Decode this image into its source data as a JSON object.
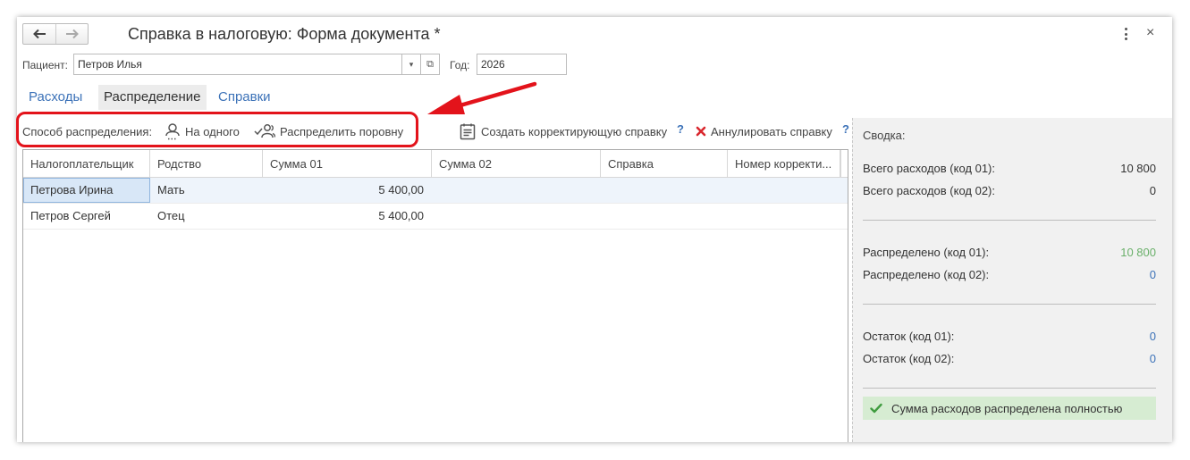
{
  "window": {
    "title": "Справка в налоговую: Форма документа *"
  },
  "header": {
    "back_icon": "arrow-left-icon",
    "forward_icon": "arrow-right-icon",
    "more_icon": "more-vertical-icon",
    "close_glyph": "×"
  },
  "patient": {
    "label": "Пациент:",
    "value": "Петров Илья",
    "dropdown_glyph": "▾",
    "open_glyph": "⧉",
    "year_label": "Год:",
    "year_value": "2026"
  },
  "tabs": [
    {
      "label": "Расходы",
      "active": false
    },
    {
      "label": "Распределение",
      "active": true
    },
    {
      "label": "Справки",
      "active": false
    }
  ],
  "toolbar": {
    "method_label": "Способ распределения:",
    "to_one_label": "На одного",
    "equal_label": "Распределить поровну",
    "create_correction_label": "Создать корректирующую справку",
    "cancel_label": "Аннулировать справку",
    "help_glyph": "?"
  },
  "table": {
    "headers": [
      "Налогоплательщик",
      "Родство",
      "Сумма 01",
      "Сумма 02",
      "Справка",
      "Номер корректи..."
    ],
    "rows": [
      {
        "payer": "Петрова Ирина",
        "relation": "Мать",
        "sum01": "5 400,00",
        "sum02": "",
        "certificate": "",
        "correction": ""
      },
      {
        "payer": "Петров Сергей",
        "relation": "Отец",
        "sum01": "5 400,00",
        "sum02": "",
        "certificate": "",
        "correction": ""
      }
    ]
  },
  "summary": {
    "title": "Сводка:",
    "total01_label": "Всего расходов (код 01):",
    "total01_value": "10 800",
    "total02_label": "Всего расходов (код 02):",
    "total02_value": "0",
    "dist01_label": "Распределено (код 01):",
    "dist01_value": "10 800",
    "dist02_label": "Распределено (код 02):",
    "dist02_value": "0",
    "rest01_label": "Остаток (код 01):",
    "rest01_value": "0",
    "rest02_label": "Остаток (код 02):",
    "rest02_value": "0",
    "status_text": "Сумма расходов распределена полностью"
  },
  "colors": {
    "accent": "#3c72b8",
    "annotation": "#e3131b",
    "success_bg": "#d6ecd2",
    "success_text": "#6ab06a"
  }
}
